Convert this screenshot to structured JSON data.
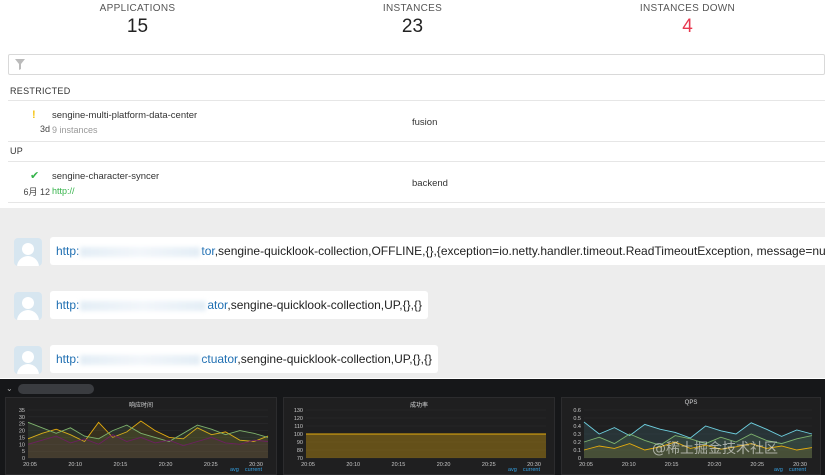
{
  "summary": {
    "applications_label": "APPLICATIONS",
    "applications_value": "15",
    "instances_label": "INSTANCES",
    "instances_value": "23",
    "down_label": "INSTANCES DOWN",
    "down_value": "4"
  },
  "filter": {
    "placeholder": ""
  },
  "groups": {
    "restricted": {
      "label": "RESTRICTED",
      "app": {
        "status_icon": "exclamation-icon",
        "time": "3d",
        "name": "sengine-multi-platform-data-center",
        "sub": "9 instances",
        "tag": "fusion"
      }
    },
    "up": {
      "label": "UP",
      "app": {
        "status_icon": "check-icon",
        "time": "6月 12",
        "name": "sengine-character-syncer",
        "sub": "http://",
        "tag": "backend"
      }
    }
  },
  "messages": [
    {
      "link": "http:",
      "tail": "tor",
      "text": ",sengine-quicklook-collection,OFFLINE,{},{exception=io.netty.handler.timeout.ReadTimeoutException, message=null}"
    },
    {
      "link": "http:",
      "tail": "ator",
      "text": ",sengine-quicklook-collection,UP,{},{}"
    },
    {
      "link": "http:",
      "tail": "ctuator",
      "text": ",sengine-quicklook-collection,UP,{},{}"
    }
  ],
  "dashboard": {
    "panels": [
      {
        "title": "响应时间",
        "legend_avg": "avg",
        "legend_current": "current"
      },
      {
        "title": "成功率",
        "legend_avg": "avg",
        "legend_current": "current"
      },
      {
        "title": "QPS",
        "legend_avg": "avg",
        "legend_current": "current"
      }
    ]
  },
  "watermark": "@稀土掘金技术社区",
  "chart_data": [
    {
      "type": "line",
      "title": "响应时间",
      "x": [
        "20:05",
        "20:10",
        "20:15",
        "20:20",
        "20:25",
        "20:30"
      ],
      "yticks": [
        "0",
        "5",
        "10",
        "15",
        "20",
        "25",
        "30",
        "35"
      ],
      "ylim": [
        0,
        35
      ],
      "series": [
        {
          "color": "#e5ac0e",
          "values": [
            14,
            18,
            21,
            17,
            12,
            26,
            15,
            19,
            27,
            20,
            15,
            14,
            22,
            17,
            19,
            13,
            12,
            16
          ]
        },
        {
          "color": "#7eb26d",
          "values": [
            26,
            22,
            18,
            22,
            16,
            14,
            20,
            24,
            18,
            15,
            12,
            18,
            24,
            21,
            17,
            20,
            18,
            15
          ]
        },
        {
          "color": "#6d1f62",
          "values": [
            10,
            13,
            16,
            11,
            14,
            10,
            17,
            12,
            15,
            11,
            13,
            9,
            12,
            15,
            11,
            10,
            13,
            12
          ]
        }
      ]
    },
    {
      "type": "area",
      "title": "成功率",
      "x": [
        "20:05",
        "20:10",
        "20:15",
        "20:20",
        "20:25",
        "20:30"
      ],
      "yticks": [
        "70",
        "80",
        "90",
        "100",
        "110",
        "120",
        "130"
      ],
      "ylim": [
        70,
        130
      ],
      "series": [
        {
          "color": "#e5ac0e",
          "values": [
            100,
            100,
            100,
            100,
            100,
            100,
            100,
            100,
            100,
            100,
            100,
            100
          ]
        }
      ]
    },
    {
      "type": "line",
      "title": "QPS",
      "x": [
        "20:05",
        "20:10",
        "20:15",
        "20:20",
        "20:25",
        "20:30"
      ],
      "yticks": [
        "0",
        "0.1",
        "0.2",
        "0.3",
        "0.4",
        "0.5",
        "0.6"
      ],
      "ylim": [
        0,
        0.6
      ],
      "series": [
        {
          "color": "#6ed0e0",
          "values": [
            0.45,
            0.3,
            0.38,
            0.28,
            0.42,
            0.36,
            0.32,
            0.25,
            0.4,
            0.34,
            0.3,
            0.44,
            0.36,
            0.27,
            0.35,
            0.3
          ]
        },
        {
          "color": "#7eb26d",
          "values": [
            0.2,
            0.26,
            0.18,
            0.3,
            0.22,
            0.16,
            0.28,
            0.24,
            0.18,
            0.26,
            0.2,
            0.3,
            0.22,
            0.18,
            0.24,
            0.28
          ]
        },
        {
          "color": "#e5ac0e",
          "values": [
            0.1,
            0.15,
            0.12,
            0.18,
            0.1,
            0.14,
            0.2,
            0.12,
            0.16,
            0.11,
            0.14,
            0.18,
            0.12,
            0.15,
            0.1,
            0.13
          ]
        }
      ]
    }
  ]
}
